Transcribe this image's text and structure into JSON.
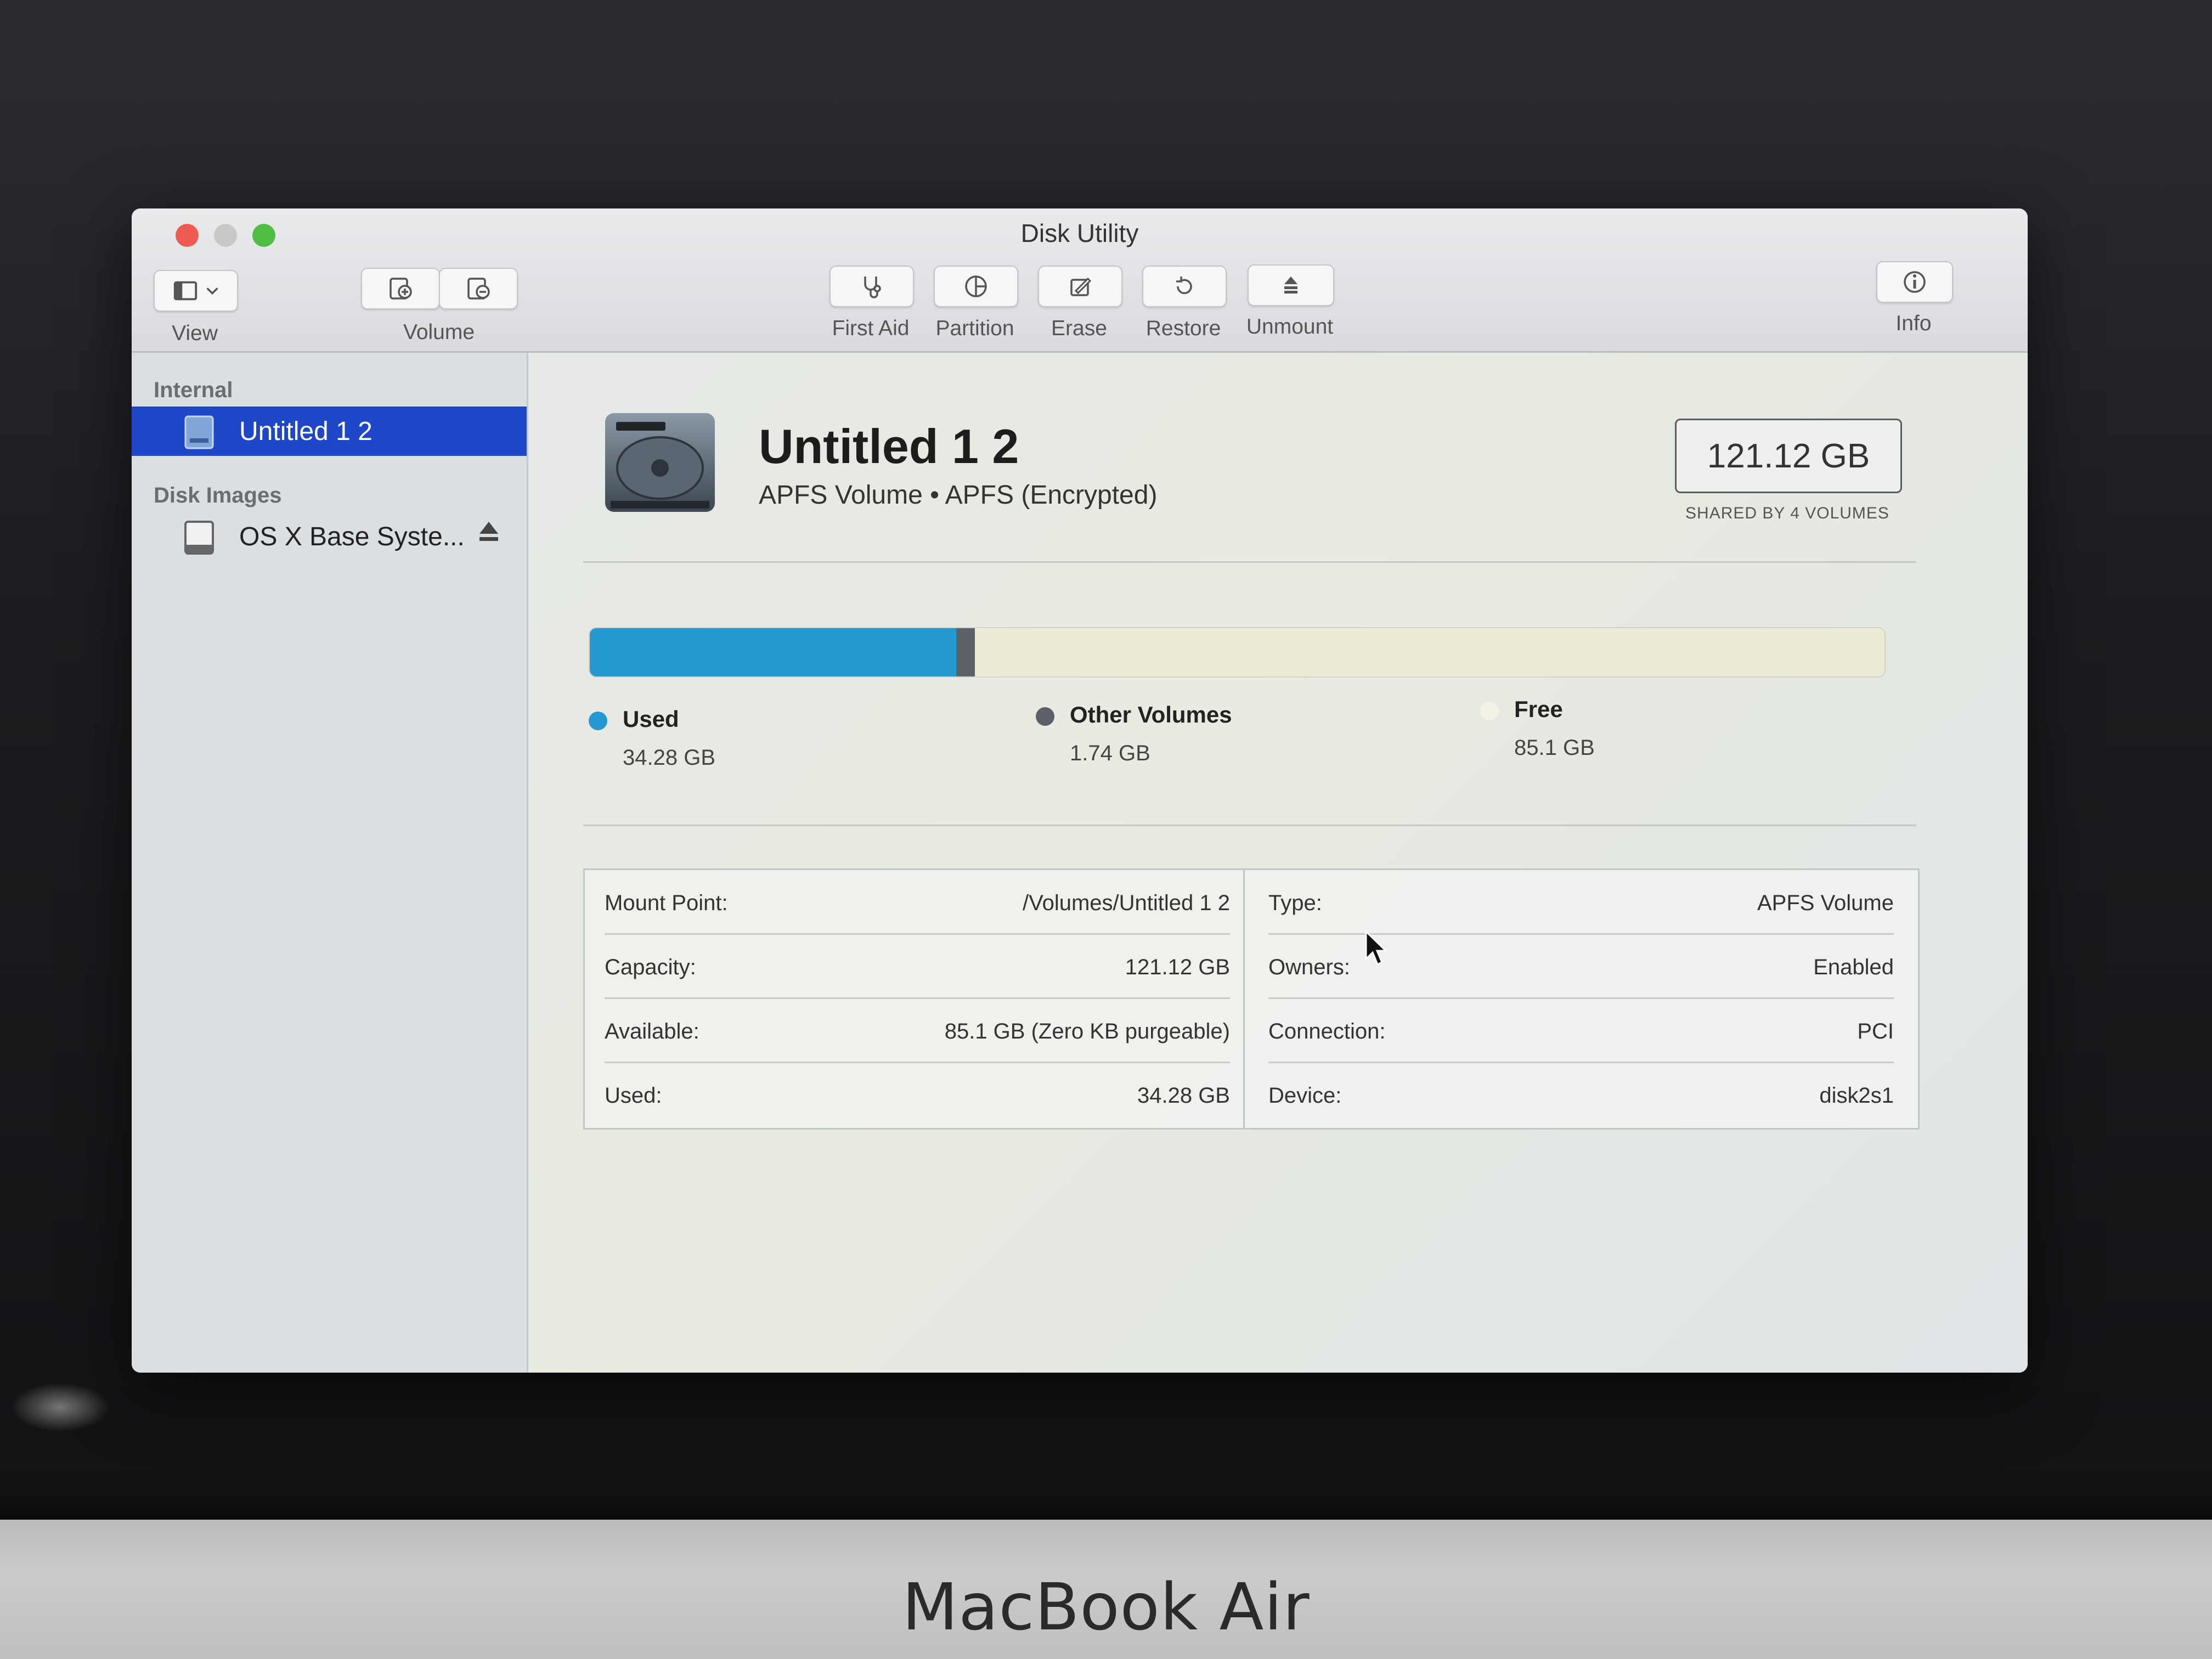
{
  "window": {
    "title": "Disk Utility"
  },
  "toolbar": {
    "view_label": "View",
    "volume_label": "Volume",
    "first_aid_label": "First Aid",
    "partition_label": "Partition",
    "erase_label": "Erase",
    "restore_label": "Restore",
    "unmount_label": "Unmount",
    "info_label": "Info"
  },
  "sidebar": {
    "internal_heading": "Internal",
    "internal_items": [
      {
        "label": "Untitled 1 2",
        "icon": "internal-disk-icon",
        "selected": true
      }
    ],
    "disk_images_heading": "Disk Images",
    "disk_image_items": [
      {
        "label": "OS X Base Syste...",
        "icon": "disk-image-icon",
        "eject": true
      }
    ]
  },
  "volume": {
    "name": "Untitled 1 2",
    "subtitle": "APFS Volume • APFS (Encrypted)",
    "capacity": "121.12 GB",
    "capacity_caption": "SHARED BY 4 VOLUMES"
  },
  "usage": {
    "used_fraction": 0.283,
    "other_fraction": 0.0144,
    "legend": [
      {
        "name": "Used",
        "value": "34.28 GB",
        "color": "#2598d1"
      },
      {
        "name": "Other Volumes",
        "value": "1.74 GB",
        "color": "#5c6167"
      },
      {
        "name": "Free",
        "value": "85.1 GB",
        "color": "#f3f2e4"
      }
    ]
  },
  "info": {
    "left": [
      {
        "key": "Mount Point:",
        "value": "/Volumes/Untitled 1 2"
      },
      {
        "key": "Capacity:",
        "value": "121.12 GB"
      },
      {
        "key": "Available:",
        "value": "85.1 GB (Zero KB purgeable)"
      },
      {
        "key": "Used:",
        "value": "34.28 GB"
      }
    ],
    "right": [
      {
        "key": "Type:",
        "value": "APFS Volume"
      },
      {
        "key": "Owners:",
        "value": "Enabled"
      },
      {
        "key": "Connection:",
        "value": "PCI"
      },
      {
        "key": "Device:",
        "value": "disk2s1"
      }
    ]
  },
  "device": {
    "brand": "MacBook Air"
  }
}
